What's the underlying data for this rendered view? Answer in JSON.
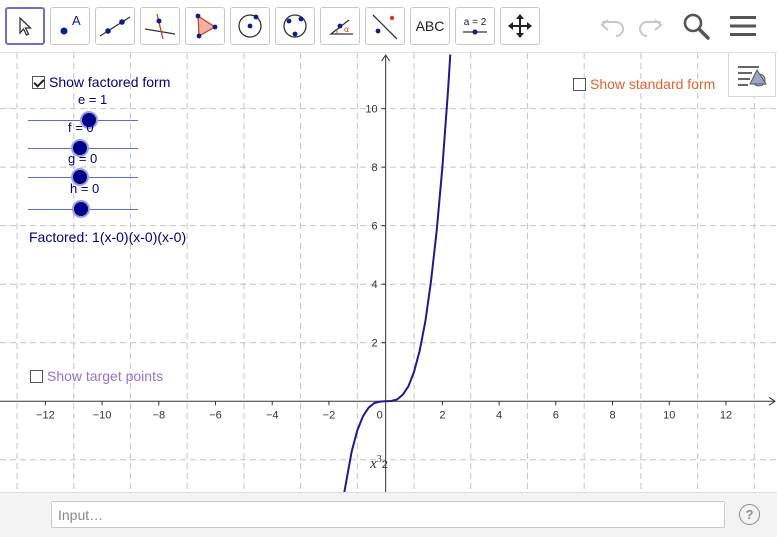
{
  "toolbar": {
    "tools": [
      {
        "name": "move-tool",
        "icon": "arrow-cursor-icon",
        "selected": true
      },
      {
        "name": "point-tool",
        "icon": "point-icon",
        "label": "A"
      },
      {
        "name": "line-tool",
        "icon": "line-icon"
      },
      {
        "name": "perpendicular-tool",
        "icon": "perpendicular-icon"
      },
      {
        "name": "polygon-tool",
        "icon": "polygon-icon"
      },
      {
        "name": "circle-center-tool",
        "icon": "circle-center-icon"
      },
      {
        "name": "circle-three-points-tool",
        "icon": "circle-three-points-icon"
      },
      {
        "name": "angle-tool",
        "icon": "angle-icon",
        "label": "α"
      },
      {
        "name": "reflect-tool",
        "icon": "reflect-icon"
      },
      {
        "name": "text-tool",
        "icon": "text-icon",
        "label": "ABC"
      },
      {
        "name": "slider-tool",
        "icon": "slider-icon",
        "label": "a = 2"
      },
      {
        "name": "move-graphics-tool",
        "icon": "move-graphics-icon"
      }
    ],
    "right": [
      "undo-icon",
      "redo-icon",
      "search-icon",
      "menu-icon"
    ]
  },
  "controls": {
    "show_factored_form": {
      "label": "Show factored form",
      "checked": true
    },
    "show_standard_form": {
      "label": "Show standard form",
      "checked": false
    },
    "show_target_points": {
      "label": "Show target points",
      "checked": false
    }
  },
  "sliders": [
    {
      "label": "e = 1",
      "value": 1
    },
    {
      "label": "f = 0",
      "value": 0
    },
    {
      "label": "g = 0",
      "value": 0
    },
    {
      "label": "h = 0",
      "value": 0
    }
  ],
  "factored_text": "Factored: 1(x-0)(x-0)(x-0)",
  "curve_label": {
    "base": "x",
    "exp": "3",
    "suffix": "2"
  },
  "chart_data": {
    "type": "line",
    "x_ticks": [
      -12,
      -10,
      -8,
      -6,
      -4,
      -2,
      0,
      2,
      4,
      6,
      8,
      10,
      12
    ],
    "x_tick_labels": [
      "−12",
      "−10",
      "−8",
      "−6",
      "−4",
      "−2",
      "0",
      "2",
      "4",
      "6",
      "8",
      "10",
      "12"
    ],
    "y_ticks": [
      2,
      4,
      6,
      8,
      10
    ],
    "y_tick_labels": [
      "2",
      "4",
      "6",
      "8",
      "10"
    ],
    "xlim": [
      -13.6,
      13.8
    ],
    "ylim": [
      -3.1,
      11.9
    ],
    "grid": true,
    "function": "x^3",
    "series": [
      {
        "color": "#1c1c8c",
        "x": [
          -1.46,
          -1.2,
          -1.0,
          -0.8,
          -0.6,
          -0.4,
          -0.2,
          0,
          0.2,
          0.4,
          0.6,
          0.8,
          1.0,
          1.2,
          1.4,
          1.6,
          1.8,
          2.0,
          2.2,
          2.28
        ],
        "y": [
          -3.11,
          -1.73,
          -1.0,
          -0.51,
          -0.22,
          -0.06,
          -0.01,
          0,
          0.01,
          0.06,
          0.22,
          0.51,
          1.0,
          1.73,
          2.74,
          4.1,
          5.83,
          8.0,
          10.65,
          11.85
        ]
      }
    ]
  },
  "colors": {
    "factored": "#000080",
    "standard": "#e86030",
    "target": "#9b71d6",
    "curve": "#1c1c8c",
    "selected_tool_border": "#6f6fc8"
  },
  "input_bar": {
    "placeholder": "Input…",
    "help_label": "?"
  }
}
